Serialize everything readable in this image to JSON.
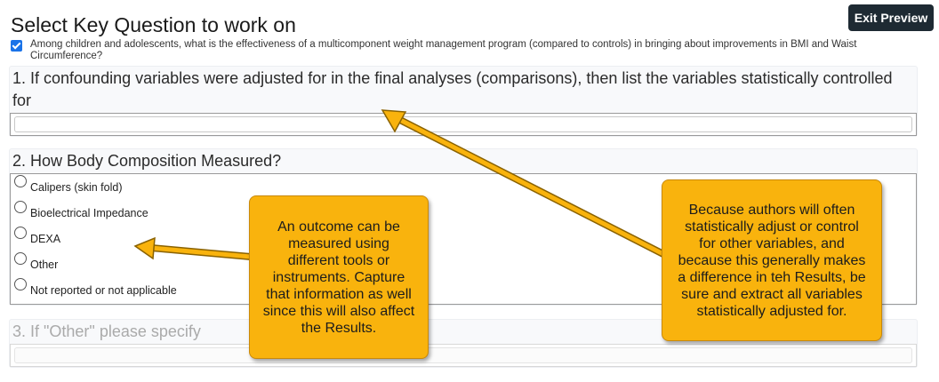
{
  "header": {
    "title": "Select Key Question to work on",
    "exit_label": "Exit Preview"
  },
  "key_question": {
    "checked": true,
    "text": "Among children and adolescents, what is the effectiveness of a multicomponent weight management program (compared to controls) in bringing about improvements in BMI and Waist Circumference?"
  },
  "questions": [
    {
      "label": "1. If confounding variables were adjusted for in the final analyses (comparisons), then list the variables statistically controlled for",
      "value": ""
    },
    {
      "label": "2. How Body Composition Measured?",
      "options": [
        "Calipers (skin fold)",
        "Bioelectrical Impedance",
        "DEXA",
        "Other",
        "Not reported or not applicable"
      ]
    },
    {
      "label": "3. If \"Other\" please specify",
      "value": "",
      "disabled": true
    }
  ],
  "callouts": {
    "left": "An outcome can be measured using different tools or instruments. Capture that information as well since this will also affect the Results.",
    "right": "Because authors will often statistically adjust or control for other variables, and because this generally makes a difference in teh Results, be sure and extract all variables statistically adjusted for."
  },
  "colors": {
    "callout_fill": "#f9b30d",
    "exit_button": "#1e2a33",
    "checkbox": "#1a73e8"
  }
}
